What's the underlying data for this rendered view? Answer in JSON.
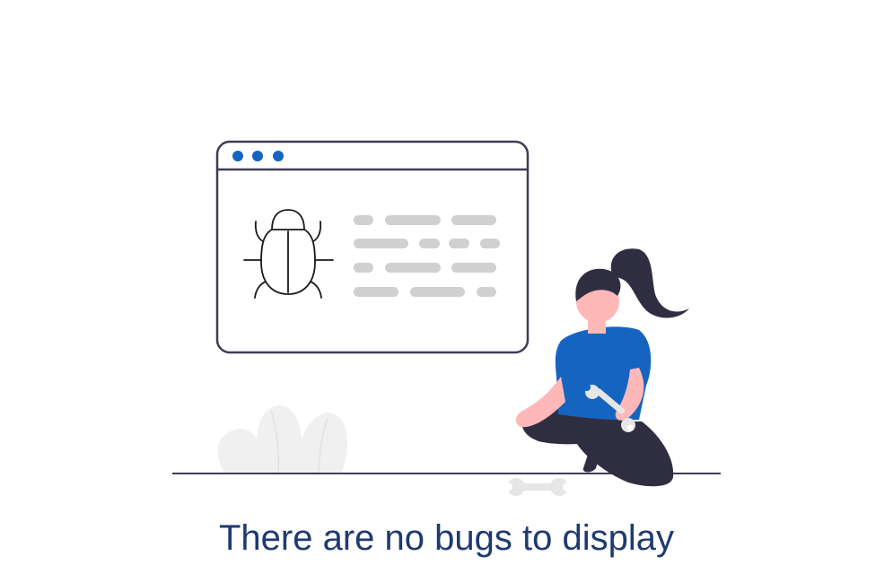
{
  "empty_state": {
    "message": "There are no bugs to display",
    "illustration": {
      "icons": [
        "browser-window-icon",
        "bug-icon",
        "wrench-icon",
        "person-illustration",
        "plant-illustration"
      ],
      "colors": {
        "accent": "#1565c0",
        "outline": "#3f3d56",
        "placeholder": "#d0d0d0",
        "plant": "#f0f0f0",
        "skin": "#ffb8b8",
        "hair": "#2f2e41",
        "text": "#1f3a6e"
      }
    }
  }
}
